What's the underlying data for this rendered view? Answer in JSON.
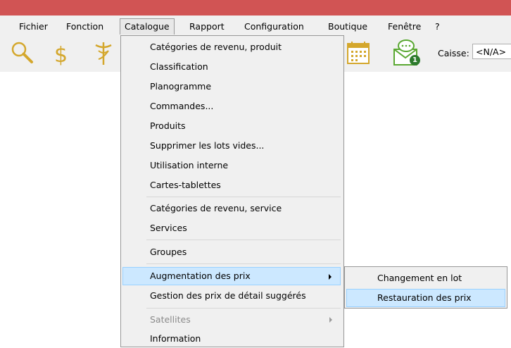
{
  "menubar": {
    "items": [
      "Fichier",
      "Fonction",
      "Catalogue",
      "Rapport",
      "Configuration",
      "Boutique",
      "Fenêtre",
      "?"
    ],
    "open_item": "Catalogue"
  },
  "toolbar": {
    "icons": [
      "search-icon",
      "dollar-icon",
      "caduceus-icon",
      "calendar-icon",
      "message-icon"
    ],
    "message_badge": "1",
    "caisse_label": "Caisse:",
    "caisse_value": "<N/A>"
  },
  "catalogue_menu": {
    "items": [
      "Catégories de revenu, produit",
      "Classification",
      "Planogramme",
      "Commandes...",
      "Produits",
      "Supprimer les lots vides...",
      "Utilisation interne",
      "Cartes-tablettes",
      "Catégories de revenu, service",
      "Services",
      "Groupes",
      "Augmentation des prix",
      "Gestion des prix de détail suggérés",
      "Satellites",
      "Information"
    ]
  },
  "submenu": {
    "items": [
      "Changement en lot",
      "Restauration des prix"
    ],
    "highlighted": "Restauration des prix"
  },
  "colors": {
    "titlebar": "#d15454",
    "menu_bg": "#f0f0f0",
    "highlight_bg": "#cce8ff",
    "highlight_border": "#99d1ff",
    "icon_gold": "#d4a72c",
    "icon_green": "#5aa832"
  }
}
